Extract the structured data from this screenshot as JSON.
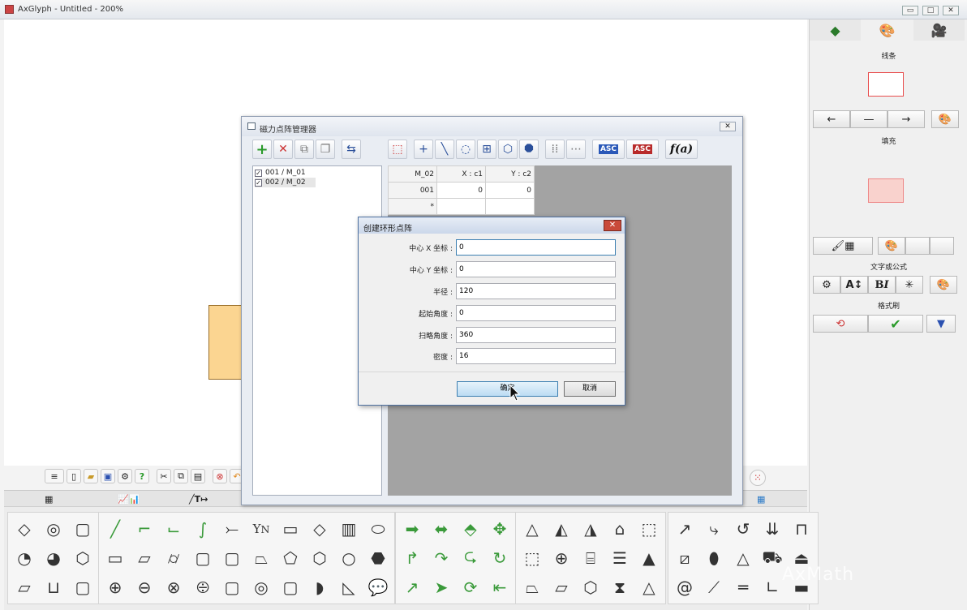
{
  "window": {
    "title": "AxGlyph - Untitled - 200%"
  },
  "right_panel": {
    "section_line": "线条",
    "section_fill": "填充",
    "section_text": "文字或公式",
    "section_brush": "格式刷",
    "line_color": "#e84c4c",
    "fill_color": "#f9d2cd"
  },
  "manager": {
    "title": "磁力点阵管理器",
    "list": [
      {
        "label": "001 / M_01",
        "checked": "✓"
      },
      {
        "label": "002 / M_02",
        "checked": "✓"
      }
    ],
    "table": {
      "headers": [
        "M_02",
        "X : c1",
        "Y : c2"
      ],
      "rows": [
        [
          "001",
          "0",
          "0"
        ],
        [
          "*",
          "",
          ""
        ]
      ]
    },
    "toolbar_text": {
      "asc_left": "ASC",
      "asc_right": "ASC",
      "fa": "f(a)"
    }
  },
  "dialog": {
    "title": "创建环形点阵",
    "fields": [
      {
        "label": "中心 X 坐标 :",
        "value": "0"
      },
      {
        "label": "中心 Y 坐标 :",
        "value": "0"
      },
      {
        "label": "半径 :",
        "value": "120"
      },
      {
        "label": "起始角度 :",
        "value": "0"
      },
      {
        "label": "扫略角度 :",
        "value": "360"
      },
      {
        "label": "密度 :",
        "value": "16"
      }
    ],
    "ok_label": "确定",
    "cancel_label": "取消"
  },
  "watermark": "AxMath"
}
